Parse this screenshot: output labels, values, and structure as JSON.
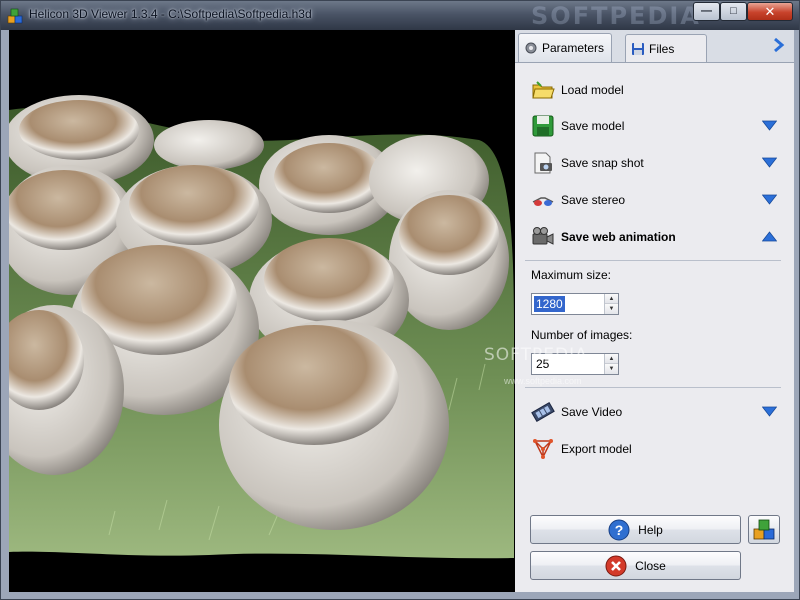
{
  "window": {
    "title": "Helicon 3D Viewer 1.3.4 - C:\\Softpedia\\Softpedia.h3d",
    "brand_watermark": "SOFTPEDIA",
    "minimize_label": "—",
    "maximize_label": "□",
    "close_label": "✕"
  },
  "tabs": {
    "parameters": "Parameters",
    "files": "Files",
    "active": "Files"
  },
  "actions": [
    {
      "label": "Load model",
      "icon": "folder-icon"
    },
    {
      "label": "Save model",
      "icon": "floppy-disk-icon",
      "dropdown": "collapsed"
    },
    {
      "label": "Save snap shot",
      "icon": "snapshot-icon",
      "dropdown": "collapsed"
    },
    {
      "label": "Save stereo",
      "icon": "stereo-glasses-icon",
      "dropdown": "collapsed"
    },
    {
      "label": "Save web animation",
      "icon": "film-camera-icon",
      "dropdown": "expanded"
    }
  ],
  "web_animation": {
    "max_size_label": "Maximum size:",
    "max_size_value": "1280",
    "num_images_label": "Number of images:",
    "num_images_value": "25"
  },
  "more_actions": [
    {
      "label": "Save Video",
      "icon": "film-strip-icon",
      "dropdown": "collapsed"
    },
    {
      "label": "Export model",
      "icon": "export-mesh-icon"
    }
  ],
  "footer": {
    "help_label": "Help",
    "close_label": "Close"
  },
  "watermark": {
    "text": "SOFTPEDIA",
    "url": "www.softpedia.com"
  },
  "colors": {
    "accent_blue": "#2b6fd8",
    "panel_bg": "#ebebef",
    "close_red": "#d33a2a"
  }
}
